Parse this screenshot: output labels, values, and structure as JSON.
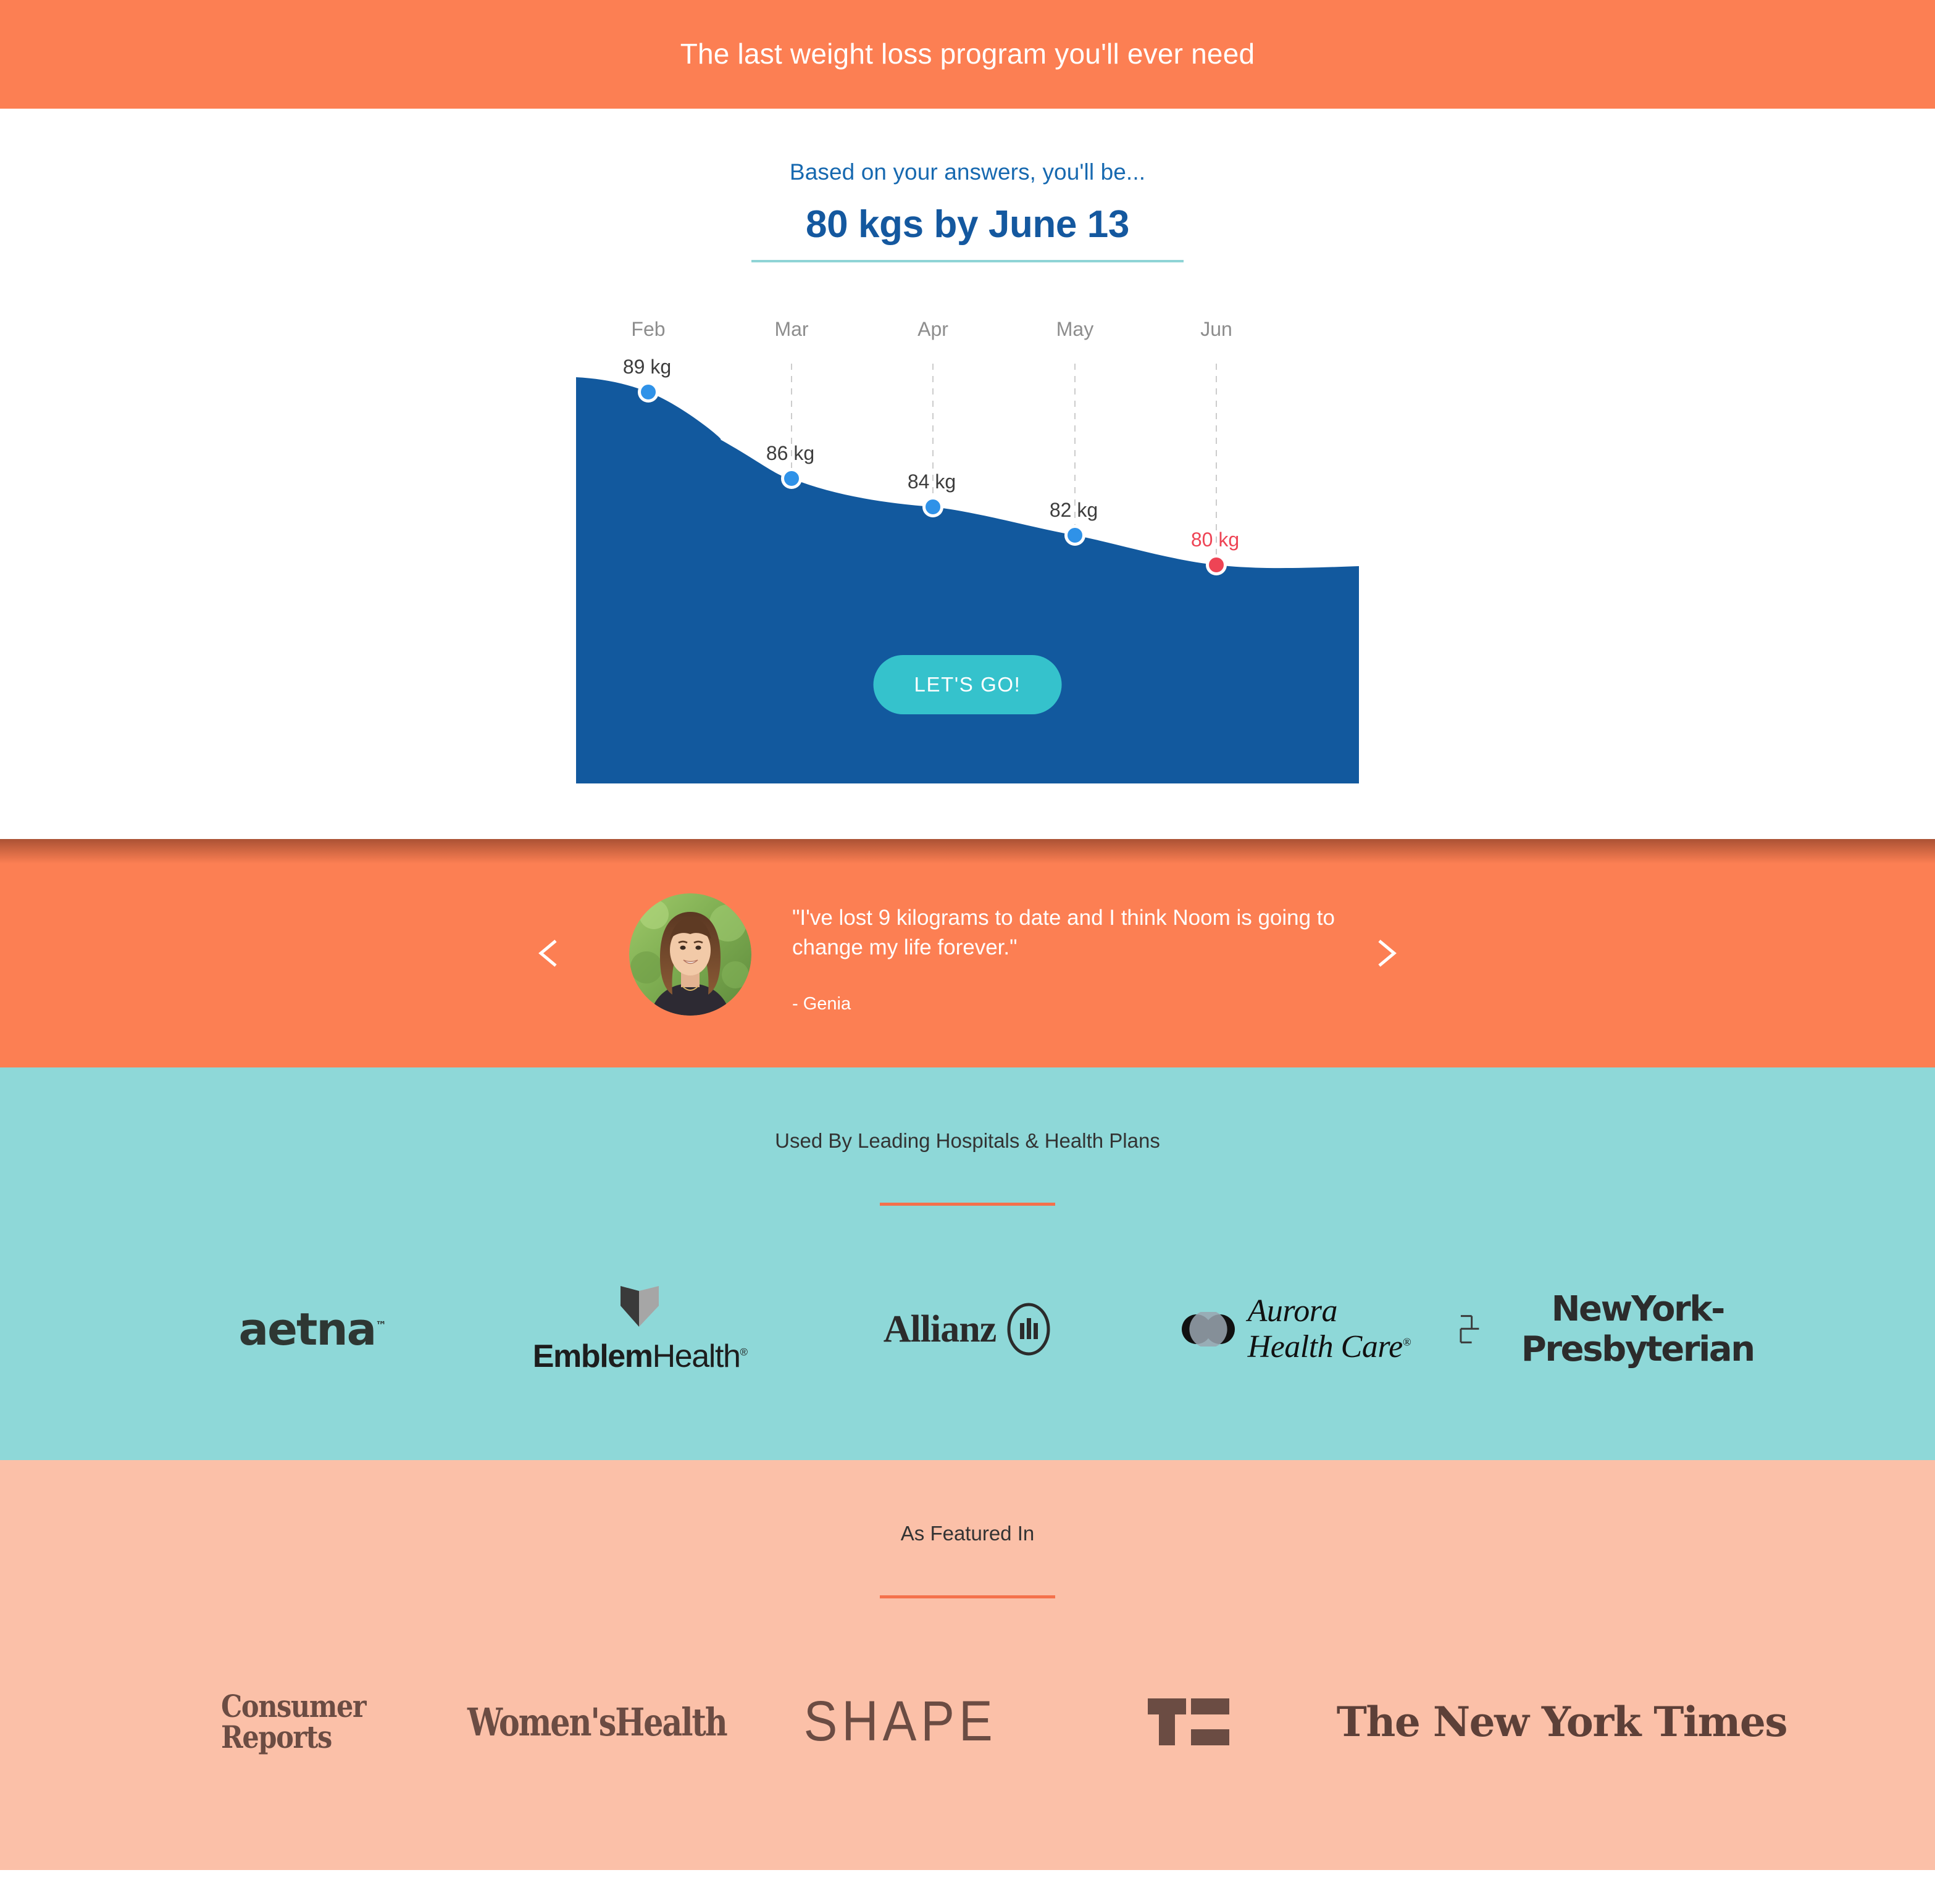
{
  "header": {
    "title": "The last weight loss program you'll ever need",
    "bg_color": "#fc7f53"
  },
  "hero": {
    "kicker": "Based on your answers, you'll be...",
    "headline": "80 kgs by June 13",
    "headline_color": "#14589f",
    "underline_color": "#8fd4d6",
    "cta_label": "LET'S GO!",
    "cta_color": "#35c2cc"
  },
  "chart_data": {
    "type": "area",
    "title": "",
    "xlabel": "",
    "ylabel": "",
    "categories": [
      "Feb",
      "Mar",
      "Apr",
      "May",
      "Jun"
    ],
    "values": [
      89,
      86,
      84,
      82,
      80
    ],
    "value_labels": [
      "89 kg",
      "86 kg",
      "84 kg",
      "82 kg",
      "80 kg"
    ],
    "unit": "kg",
    "ylim": [
      78,
      91
    ],
    "grid": "dashed-vertical",
    "legend": "none",
    "area_color": "#12599e",
    "point_color": "#2f92e8",
    "final_point_color": "#ee4455",
    "final_point_index": 4,
    "axis_label_color": "#8d8d8d"
  },
  "testimonial": {
    "quote": "\"I've lost 9 kilograms to date and I think Noom is going to change my life forever.\"",
    "author": "- Genia",
    "prev_icon": "chevron-left-icon",
    "next_icon": "chevron-right-icon",
    "avatar_alt": "Genia portrait",
    "bg_color": "#fc7f53"
  },
  "partners": {
    "heading": "Used By Leading Hospitals & Health Plans",
    "divider_color": "#f4714b",
    "bg_color": "#8ed8d8",
    "logos": [
      {
        "name": "aetna",
        "text": "aetna"
      },
      {
        "name": "emblemhealth",
        "text_bold": "Emblem",
        "text_thin": "Health"
      },
      {
        "name": "allianz",
        "text": "Allianz"
      },
      {
        "name": "aurora-health-care",
        "line1": "Aurora",
        "line2": "Health Care"
      },
      {
        "name": "newyork-presbyterian",
        "text": "NewYork-Presbyterian"
      }
    ]
  },
  "featured": {
    "heading": "As Featured In",
    "divider_color": "#f4714b",
    "bg_color": "#fbc0a8",
    "logos": [
      {
        "name": "consumer-reports",
        "line1": "Consumer",
        "line2": "Reports"
      },
      {
        "name": "womens-health",
        "text": "Women'sHealth"
      },
      {
        "name": "shape",
        "text": "SHAPE"
      },
      {
        "name": "techcrunch",
        "text": "TC"
      },
      {
        "name": "the-new-york-times",
        "text": "The New York Times"
      }
    ]
  }
}
